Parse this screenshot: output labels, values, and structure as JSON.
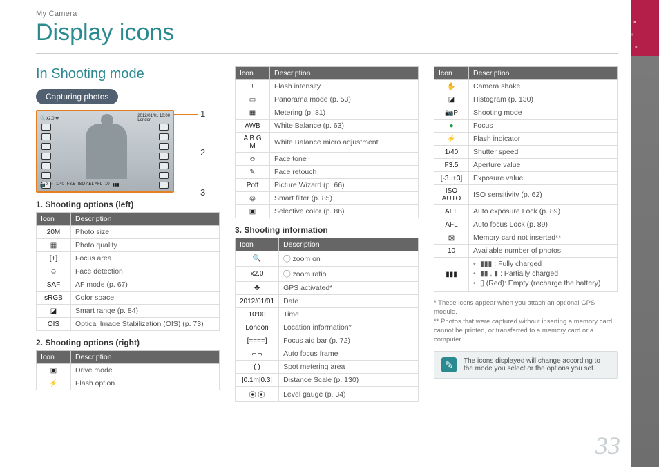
{
  "breadcrumb": "My Camera",
  "page_title": "Display icons",
  "section_title": "In Shooting mode",
  "pill": "Capturing photos",
  "callouts": {
    "c1": "1",
    "c2": "2",
    "c3": "3"
  },
  "lcd": {
    "date": "2012/01/01",
    "time": "10:00",
    "loc": "London",
    "shutter": "1/40",
    "aperture": "F3.5",
    "shots": "10"
  },
  "headers": {
    "icon": "Icon",
    "desc": "Description"
  },
  "subheads": {
    "left": "1. Shooting options (left)",
    "right": "2. Shooting options (right)",
    "info": "3. Shooting information"
  },
  "table_left": [
    {
      "icon": "20M",
      "desc": "Photo size"
    },
    {
      "icon": "▦",
      "desc": "Photo quality"
    },
    {
      "icon": "[+]",
      "desc": "Focus area"
    },
    {
      "icon": "☺",
      "desc": "Face detection"
    },
    {
      "icon": "SAF",
      "desc": "AF mode (p. 67)"
    },
    {
      "icon": "sRGB",
      "desc": "Color space"
    },
    {
      "icon": "◪",
      "desc": "Smart range (p. 84)"
    },
    {
      "icon": "OIS",
      "desc": "Optical Image Stabilization (OIS) (p. 73)"
    }
  ],
  "table_right_top": [
    {
      "icon": "▣",
      "desc": "Drive mode"
    },
    {
      "icon": "⚡",
      "desc": "Flash option"
    }
  ],
  "table_col2_top": [
    {
      "icon": "±",
      "desc": "Flash intensity"
    },
    {
      "icon": "▭",
      "desc": "Panorama mode (p. 53)"
    },
    {
      "icon": "▦",
      "desc": "Metering (p. 81)"
    },
    {
      "icon": "AWB",
      "desc": "White Balance (p. 63)"
    },
    {
      "icon": "A B\nG M",
      "desc": "White Balance micro adjustment"
    },
    {
      "icon": "☺",
      "desc": "Face tone"
    },
    {
      "icon": "✎",
      "desc": "Face retouch"
    },
    {
      "icon": "Poff",
      "desc": "Picture Wizard (p. 66)"
    },
    {
      "icon": "◎",
      "desc": "Smart filter (p. 85)"
    },
    {
      "icon": "▣",
      "desc": "Selective color (p. 86)"
    }
  ],
  "table_info": [
    {
      "icon": "🔍",
      "desc": "ⓘ zoom on"
    },
    {
      "icon": "x2.0",
      "desc": "ⓘ zoom ratio"
    },
    {
      "icon": "✥",
      "desc": "GPS activated*"
    },
    {
      "icon": "2012/01/01",
      "desc": "Date"
    },
    {
      "icon": "10:00",
      "desc": "Time"
    },
    {
      "icon": "London",
      "desc": "Location information*"
    },
    {
      "icon": "[====]",
      "desc": "Focus aid bar (p. 72)"
    },
    {
      "icon": "⌐ ¬",
      "desc": "Auto focus frame"
    },
    {
      "icon": "(  )",
      "desc": "Spot metering area"
    },
    {
      "icon": "|0.1m|0.3|",
      "desc": "Distance Scale (p. 130)"
    },
    {
      "icon": "⦿ ⦿",
      "desc": "Level gauge (p. 34)"
    }
  ],
  "table_col3": [
    {
      "icon": "✋",
      "desc": "Camera shake"
    },
    {
      "icon": "◪",
      "desc": "Histogram (p. 130)"
    },
    {
      "icon": "📷P",
      "desc": "Shooting mode"
    },
    {
      "icon": "●",
      "desc": "Focus",
      "green": true
    },
    {
      "icon": "⚡",
      "desc": "Flash indicator"
    },
    {
      "icon": "1/40",
      "desc": "Shutter speed"
    },
    {
      "icon": "F3.5",
      "desc": "Aperture value"
    },
    {
      "icon": "[-3..+3]",
      "desc": "Exposure value"
    },
    {
      "icon": "ISO\nAUTO",
      "desc": "ISO sensitivity (p. 62)"
    },
    {
      "icon": "AEL",
      "desc": "Auto exposure Lock (p. 89)"
    },
    {
      "icon": "AFL",
      "desc": "Auto focus Lock (p. 89)"
    },
    {
      "icon": "▧",
      "desc": "Memory card not inserted**"
    },
    {
      "icon": "10",
      "desc": "Available number of photos"
    }
  ],
  "battery_row": {
    "icon": "▮▮▮",
    "bullets": [
      "▮▮▮ : Fully charged",
      "▮▮ , ▮ : Partially charged",
      "▯ (Red): Empty (recharge the battery)"
    ]
  },
  "footnotes": {
    "f1": "* These icons appear when you attach an optional GPS module.",
    "f2": "** Photos that were captured without inserting a memory card cannot be printed, or transferred to a memory card or a computer."
  },
  "note": "The icons displayed will change according to the mode you select or the options you set.",
  "page_number": "33"
}
